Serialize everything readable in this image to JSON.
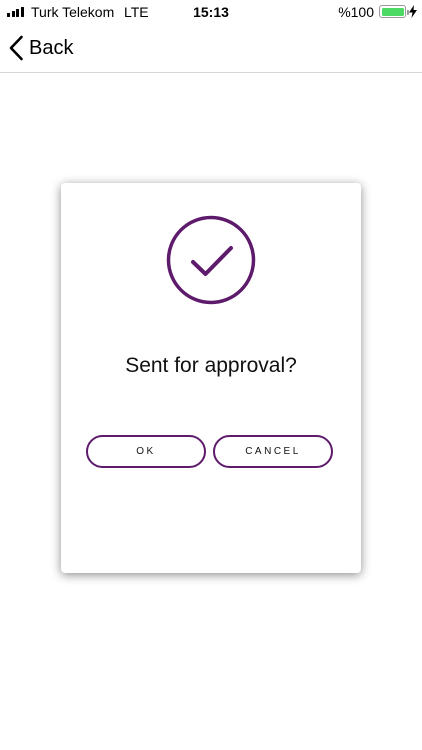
{
  "status_bar": {
    "carrier": "Turk Telekom",
    "network": "LTE",
    "time": "15:13",
    "battery_percent": "%100",
    "battery_level": 1.0,
    "battery_color": "#4cd964",
    "signal_bars": 4
  },
  "nav": {
    "back_label": "Back",
    "back_icon": "chevron-left-icon"
  },
  "dialog": {
    "icon": "checkmark-circle-icon",
    "accent_color": "#5e1a6b",
    "message": "Sent for approval?",
    "ok_label": "OK",
    "cancel_label": "CANCEL"
  }
}
